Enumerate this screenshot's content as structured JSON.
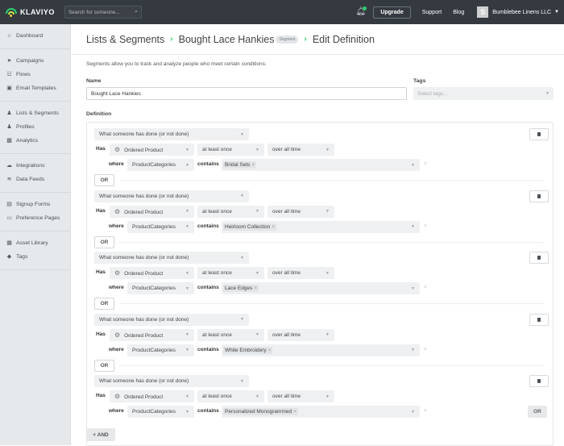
{
  "topbar": {
    "logo_text": "KLAVIYO",
    "search_placeholder": "Search for someone...",
    "upgrade_label": "Upgrade",
    "support_label": "Support",
    "blog_label": "Blog",
    "account_initial": "S",
    "account_name": "Bumblebee Linens LLC"
  },
  "sidebar": {
    "groups": [
      [
        {
          "label": "Dashboard",
          "icon": "home-icon"
        }
      ],
      [
        {
          "label": "Campaigns",
          "icon": "paper-plane-icon"
        },
        {
          "label": "Flows",
          "icon": "flow-icon"
        },
        {
          "label": "Email Templates",
          "icon": "template-icon"
        }
      ],
      [
        {
          "label": "Lists & Segments",
          "icon": "users-icon"
        },
        {
          "label": "Profiles",
          "icon": "user-icon"
        },
        {
          "label": "Analytics",
          "icon": "bar-chart-icon"
        }
      ],
      [
        {
          "label": "Integrations",
          "icon": "cloud-icon"
        },
        {
          "label": "Data Feeds",
          "icon": "rss-icon"
        }
      ],
      [
        {
          "label": "Signup Forms",
          "icon": "form-icon"
        },
        {
          "label": "Preference Pages",
          "icon": "window-icon"
        }
      ],
      [
        {
          "label": "Asset Library",
          "icon": "image-icon"
        },
        {
          "label": "Tags",
          "icon": "tag-icon"
        }
      ]
    ]
  },
  "header": {
    "crumb1": "Lists & Segments",
    "crumb2": "Bought Lace Hankies",
    "badge": "Segment",
    "crumb3": "Edit Definition"
  },
  "form": {
    "description": "Segments allow you to track and analyze people who meet certain conditions:",
    "name_label": "Name",
    "name_value": "Bought Lace Hankies",
    "tags_label": "Tags",
    "tags_placeholder": "Select tags...",
    "definition_label": "Definition"
  },
  "conditions": [
    {
      "type": "What someone has done (or not done)",
      "has": "Has",
      "metric": "Ordered Product",
      "frequency": "at least once",
      "timeframe": "over all time",
      "where": "where",
      "property": "ProductCategories",
      "operator": "contains",
      "value": "Bridal Sets"
    },
    {
      "type": "What someone has done (or not done)",
      "has": "Has",
      "metric": "Ordered Product",
      "frequency": "at least once",
      "timeframe": "over all time",
      "where": "where",
      "property": "ProductCategories",
      "operator": "contains",
      "value": "Heirloom Collection"
    },
    {
      "type": "What someone has done (or not done)",
      "has": "Has",
      "metric": "Ordered Product",
      "frequency": "at least once",
      "timeframe": "over all time",
      "where": "where",
      "property": "ProductCategories",
      "operator": "contains",
      "value": "Lace Edges"
    },
    {
      "type": "What someone has done (or not done)",
      "has": "Has",
      "metric": "Ordered Product",
      "frequency": "at least once",
      "timeframe": "over all time",
      "where": "where",
      "property": "ProductCategories",
      "operator": "contains",
      "value": "White Embroidery"
    },
    {
      "type": "What someone has done (or not done)",
      "has": "Has",
      "metric": "Ordered Product",
      "frequency": "at least once",
      "timeframe": "over all time",
      "where": "where",
      "property": "ProductCategories",
      "operator": "contains",
      "value": "Personalized Monogrammed"
    }
  ],
  "buttons": {
    "or_label": "OR",
    "and_label": "+ AND"
  }
}
